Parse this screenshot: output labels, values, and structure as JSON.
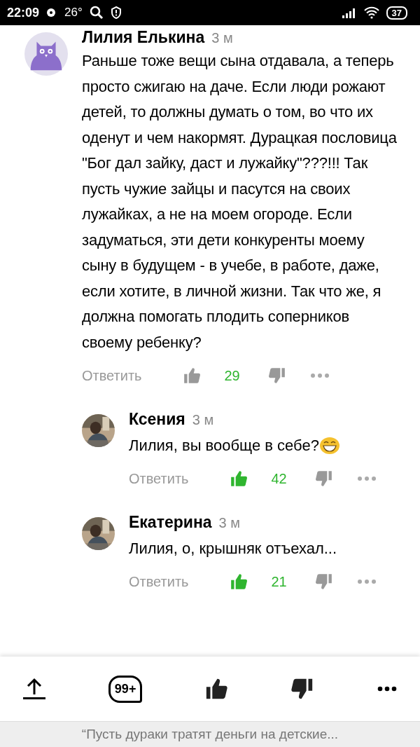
{
  "status_bar": {
    "time": "22:09",
    "temperature": "26°",
    "battery": "37"
  },
  "comments": [
    {
      "author": "Лилия Елькина",
      "age": "3 м",
      "avatar": {
        "kind": "owl"
      },
      "text": "Раньше тоже вещи сына отдавала, а теперь просто сжигаю на даче. Если люди рожают детей, то должны думать о том, во что их оденут и чем накормят. Дурацкая пословица \"Бог дал зайку, даст и лужайку\"???!!! Так пусть чужие зайцы и пасутся на своих лужайках, а не на моем огороде. Если задуматься, эти дети конкуренты моему сыну в будущем - в учебе, в работе, даже, если хотите, в личной жизни. Так что же, я должна помогать плодить соперников своему ребенку?",
      "reply_label": "Ответить",
      "likes": "29",
      "liked": false,
      "children": [
        {
          "author": "Ксения",
          "age": "3 м",
          "text": "Лилия, вы вообще в себе?",
          "emoji": true,
          "reply_label": "Ответить",
          "likes": "42",
          "liked": true
        },
        {
          "author": "Екатерина",
          "age": "3 м",
          "text": "Лилия, о, крышняк отъехал...",
          "emoji": false,
          "reply_label": "Ответить",
          "likes": "21",
          "liked": true
        }
      ]
    }
  ],
  "bottom_bar": {
    "comment_count": "99+"
  },
  "footer": {
    "quote": "“Пусть дураки тратят деньги на детские..."
  }
}
